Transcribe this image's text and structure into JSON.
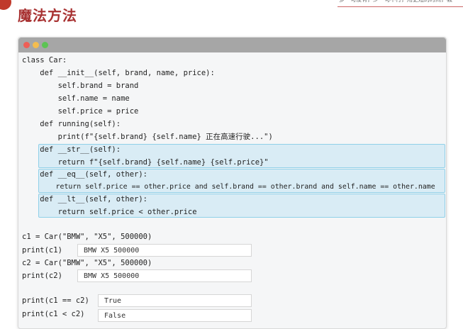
{
  "page": {
    "title": "魔法方法",
    "top_note": "多一句没有，少一句不行，用更短的时间，教"
  },
  "code": {
    "lines": [
      "class Car:",
      "    def __init__(self, brand, name, price):",
      "        self.brand = brand",
      "        self.name = name",
      "        self.price = price",
      "    def running(self):",
      "        print(f\"{self.brand} {self.name} 正在高速行驶...\")",
      "    def __str__(self):",
      "        return f\"{self.brand} {self.name} {self.price}\"",
      "    def __eq__(self, other):",
      "        return self.price == other.price and self.brand == other.brand and self.name == other.name",
      "    def __lt__(self, other):",
      "        return self.price < other.price",
      "c1 = Car(\"BMW\", \"X5\", 500000)",
      "print(c1)",
      "c2 = Car(\"BMW\", \"X5\", 500000)",
      "print(c2)",
      "print(c1 == c2)",
      "print(c1 < c2)"
    ]
  },
  "outputs": [
    "BMW X5 500000",
    "BMW X5 500000",
    "True",
    "False"
  ],
  "colors": {
    "title": "#a83232",
    "keyword": "#1f4fa3",
    "self": "#8b3a9b",
    "string": "#2b7a2b",
    "highlight_bg": "#d9ecf5",
    "highlight_border": "#8fd0e8"
  }
}
